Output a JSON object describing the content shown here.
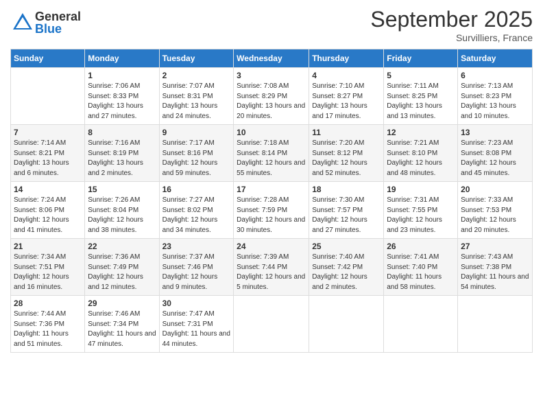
{
  "header": {
    "logo_general": "General",
    "logo_blue": "Blue",
    "month": "September 2025",
    "location": "Survilliers, France"
  },
  "days_of_week": [
    "Sunday",
    "Monday",
    "Tuesday",
    "Wednesday",
    "Thursday",
    "Friday",
    "Saturday"
  ],
  "weeks": [
    [
      {
        "day": "",
        "sunrise": "",
        "sunset": "",
        "daylight": ""
      },
      {
        "day": "1",
        "sunrise": "Sunrise: 7:06 AM",
        "sunset": "Sunset: 8:33 PM",
        "daylight": "Daylight: 13 hours and 27 minutes."
      },
      {
        "day": "2",
        "sunrise": "Sunrise: 7:07 AM",
        "sunset": "Sunset: 8:31 PM",
        "daylight": "Daylight: 13 hours and 24 minutes."
      },
      {
        "day": "3",
        "sunrise": "Sunrise: 7:08 AM",
        "sunset": "Sunset: 8:29 PM",
        "daylight": "Daylight: 13 hours and 20 minutes."
      },
      {
        "day": "4",
        "sunrise": "Sunrise: 7:10 AM",
        "sunset": "Sunset: 8:27 PM",
        "daylight": "Daylight: 13 hours and 17 minutes."
      },
      {
        "day": "5",
        "sunrise": "Sunrise: 7:11 AM",
        "sunset": "Sunset: 8:25 PM",
        "daylight": "Daylight: 13 hours and 13 minutes."
      },
      {
        "day": "6",
        "sunrise": "Sunrise: 7:13 AM",
        "sunset": "Sunset: 8:23 PM",
        "daylight": "Daylight: 13 hours and 10 minutes."
      }
    ],
    [
      {
        "day": "7",
        "sunrise": "Sunrise: 7:14 AM",
        "sunset": "Sunset: 8:21 PM",
        "daylight": "Daylight: 13 hours and 6 minutes."
      },
      {
        "day": "8",
        "sunrise": "Sunrise: 7:16 AM",
        "sunset": "Sunset: 8:19 PM",
        "daylight": "Daylight: 13 hours and 2 minutes."
      },
      {
        "day": "9",
        "sunrise": "Sunrise: 7:17 AM",
        "sunset": "Sunset: 8:16 PM",
        "daylight": "Daylight: 12 hours and 59 minutes."
      },
      {
        "day": "10",
        "sunrise": "Sunrise: 7:18 AM",
        "sunset": "Sunset: 8:14 PM",
        "daylight": "Daylight: 12 hours and 55 minutes."
      },
      {
        "day": "11",
        "sunrise": "Sunrise: 7:20 AM",
        "sunset": "Sunset: 8:12 PM",
        "daylight": "Daylight: 12 hours and 52 minutes."
      },
      {
        "day": "12",
        "sunrise": "Sunrise: 7:21 AM",
        "sunset": "Sunset: 8:10 PM",
        "daylight": "Daylight: 12 hours and 48 minutes."
      },
      {
        "day": "13",
        "sunrise": "Sunrise: 7:23 AM",
        "sunset": "Sunset: 8:08 PM",
        "daylight": "Daylight: 12 hours and 45 minutes."
      }
    ],
    [
      {
        "day": "14",
        "sunrise": "Sunrise: 7:24 AM",
        "sunset": "Sunset: 8:06 PM",
        "daylight": "Daylight: 12 hours and 41 minutes."
      },
      {
        "day": "15",
        "sunrise": "Sunrise: 7:26 AM",
        "sunset": "Sunset: 8:04 PM",
        "daylight": "Daylight: 12 hours and 38 minutes."
      },
      {
        "day": "16",
        "sunrise": "Sunrise: 7:27 AM",
        "sunset": "Sunset: 8:02 PM",
        "daylight": "Daylight: 12 hours and 34 minutes."
      },
      {
        "day": "17",
        "sunrise": "Sunrise: 7:28 AM",
        "sunset": "Sunset: 7:59 PM",
        "daylight": "Daylight: 12 hours and 30 minutes."
      },
      {
        "day": "18",
        "sunrise": "Sunrise: 7:30 AM",
        "sunset": "Sunset: 7:57 PM",
        "daylight": "Daylight: 12 hours and 27 minutes."
      },
      {
        "day": "19",
        "sunrise": "Sunrise: 7:31 AM",
        "sunset": "Sunset: 7:55 PM",
        "daylight": "Daylight: 12 hours and 23 minutes."
      },
      {
        "day": "20",
        "sunrise": "Sunrise: 7:33 AM",
        "sunset": "Sunset: 7:53 PM",
        "daylight": "Daylight: 12 hours and 20 minutes."
      }
    ],
    [
      {
        "day": "21",
        "sunrise": "Sunrise: 7:34 AM",
        "sunset": "Sunset: 7:51 PM",
        "daylight": "Daylight: 12 hours and 16 minutes."
      },
      {
        "day": "22",
        "sunrise": "Sunrise: 7:36 AM",
        "sunset": "Sunset: 7:49 PM",
        "daylight": "Daylight: 12 hours and 12 minutes."
      },
      {
        "day": "23",
        "sunrise": "Sunrise: 7:37 AM",
        "sunset": "Sunset: 7:46 PM",
        "daylight": "Daylight: 12 hours and 9 minutes."
      },
      {
        "day": "24",
        "sunrise": "Sunrise: 7:39 AM",
        "sunset": "Sunset: 7:44 PM",
        "daylight": "Daylight: 12 hours and 5 minutes."
      },
      {
        "day": "25",
        "sunrise": "Sunrise: 7:40 AM",
        "sunset": "Sunset: 7:42 PM",
        "daylight": "Daylight: 12 hours and 2 minutes."
      },
      {
        "day": "26",
        "sunrise": "Sunrise: 7:41 AM",
        "sunset": "Sunset: 7:40 PM",
        "daylight": "Daylight: 11 hours and 58 minutes."
      },
      {
        "day": "27",
        "sunrise": "Sunrise: 7:43 AM",
        "sunset": "Sunset: 7:38 PM",
        "daylight": "Daylight: 11 hours and 54 minutes."
      }
    ],
    [
      {
        "day": "28",
        "sunrise": "Sunrise: 7:44 AM",
        "sunset": "Sunset: 7:36 PM",
        "daylight": "Daylight: 11 hours and 51 minutes."
      },
      {
        "day": "29",
        "sunrise": "Sunrise: 7:46 AM",
        "sunset": "Sunset: 7:34 PM",
        "daylight": "Daylight: 11 hours and 47 minutes."
      },
      {
        "day": "30",
        "sunrise": "Sunrise: 7:47 AM",
        "sunset": "Sunset: 7:31 PM",
        "daylight": "Daylight: 11 hours and 44 minutes."
      },
      {
        "day": "",
        "sunrise": "",
        "sunset": "",
        "daylight": ""
      },
      {
        "day": "",
        "sunrise": "",
        "sunset": "",
        "daylight": ""
      },
      {
        "day": "",
        "sunrise": "",
        "sunset": "",
        "daylight": ""
      },
      {
        "day": "",
        "sunrise": "",
        "sunset": "",
        "daylight": ""
      }
    ]
  ]
}
